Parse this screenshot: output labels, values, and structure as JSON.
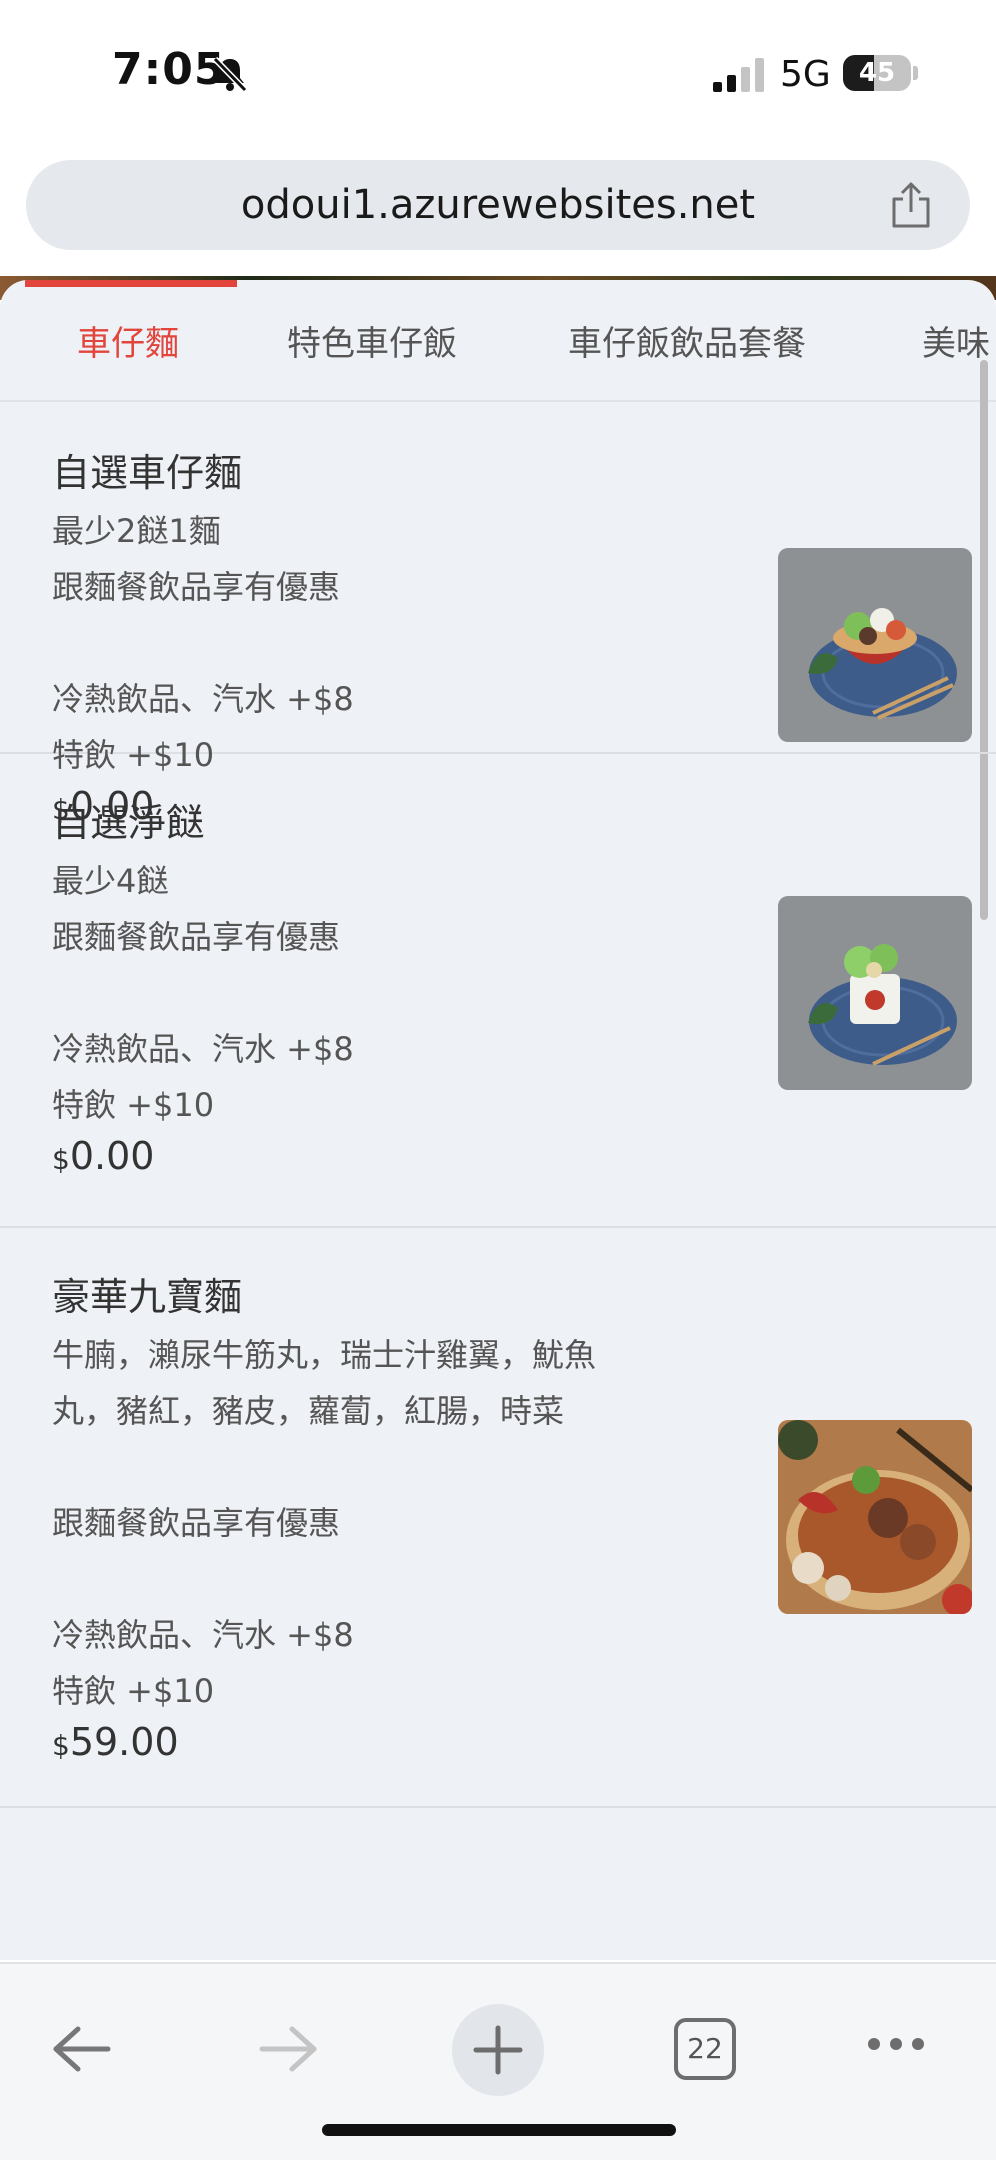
{
  "status_bar": {
    "time": "7:05",
    "network": "5G",
    "battery_percent": "45",
    "battery_level": 0.45,
    "icons": [
      "bell-slash-icon",
      "cellular-signal-icon",
      "battery-icon"
    ]
  },
  "browser": {
    "url": "odoui1.azurewebsites.net",
    "share_icon": "share-icon",
    "tab_count": "22"
  },
  "categories": {
    "tabs": [
      "車仔麵",
      "特色車仔飯",
      "車仔飯飲品套餐",
      "美味"
    ],
    "active_index": 0,
    "accent_color": "#e2453c"
  },
  "menu": {
    "items": [
      {
        "name": "自選車仔麵",
        "desc": [
          "最少2餸1麵",
          "跟麵餐飲品享有優惠",
          "",
          "冷熱飲品、汽水 +$8",
          "特飲 +$10"
        ],
        "currency": "$",
        "price": "0.00"
      },
      {
        "name": "自選淨餸",
        "desc": [
          "最少4餸",
          "跟麵餐飲品享有優惠",
          "",
          "冷熱飲品、汽水 +$8",
          "特飲 +$10"
        ],
        "currency": "$",
        "price": "0.00"
      },
      {
        "name": "豪華九寶麵",
        "desc": [
          "牛腩，瀨尿牛筋丸，瑞士汁雞翼，魷魚",
          "丸，豬紅，豬皮，蘿蔔，紅腸，時菜",
          "",
          "跟麵餐飲品享有優惠",
          "",
          "冷熱飲品、汽水 +$8",
          "特飲 +$10"
        ],
        "currency": "$",
        "price": "59.00"
      }
    ]
  }
}
